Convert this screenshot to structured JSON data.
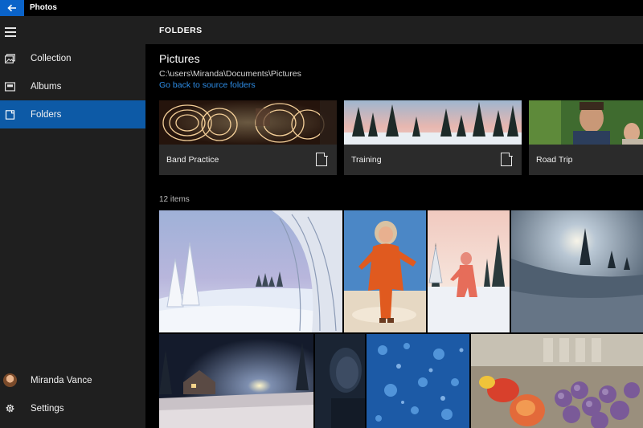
{
  "app": {
    "title": "Photos"
  },
  "sidebar": {
    "items": [
      {
        "label": "Collection",
        "icon": "collection-icon"
      },
      {
        "label": "Albums",
        "icon": "albums-icon"
      },
      {
        "label": "Folders",
        "icon": "folder-icon",
        "active": true
      }
    ],
    "user": {
      "name": "Miranda Vance"
    },
    "settings_label": "Settings"
  },
  "main": {
    "header_title": "FOLDERS",
    "folder_title": "Pictures",
    "folder_path": "C:\\users\\Miranda\\Documents\\Pictures",
    "back_link": "Go back to source folders",
    "subfolders": [
      {
        "label": "Band Practice"
      },
      {
        "label": "Training"
      },
      {
        "label": "Road Trip"
      }
    ],
    "items_count": "12 items"
  },
  "colors": {
    "accent": "#0d5aa6",
    "link": "#2e8ee8",
    "sidebar_bg": "#1f1f1f",
    "tile_bg": "#2b2b2b"
  }
}
